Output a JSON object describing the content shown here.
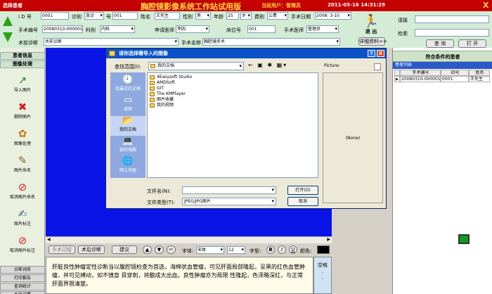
{
  "titlebar": {
    "app_name": "选择患者",
    "title": "胸腔镜影像系统工作站试用版",
    "user": "当前用户：管理员",
    "clock": "2011-05-16 14:31:29",
    "close": "X"
  },
  "form": {
    "row1": {
      "id_label": "I D 号",
      "id_value": "0001",
      "visit_label": "诊别",
      "visit_value": "急诊",
      "no_label": "号",
      "no_value": "001",
      "name_label": "姓名",
      "name_value": "王先生",
      "sex_label": "性别",
      "sex_value": "男",
      "age_label": "年龄",
      "age_value": "25",
      "age_unit_value": "岁",
      "fee_label": "费别",
      "fee_value": "公费",
      "date_label": "手术日期",
      "date_value": "2008- 3-10"
    },
    "row2": {
      "opno_label": "手术编号",
      "opno_value": "20080310-000001",
      "dept_label": "科别",
      "dept_value": "内科",
      "doctor_label": "申请医师",
      "doctor_value": "李四",
      "bed_label": "床位号",
      "bed_value": "001",
      "surgeon_label": "手术医师",
      "surgeon_value": "管理员"
    },
    "row3": {
      "preop_label": "术前诊断",
      "preop_value": "术前诊断",
      "opname_label": "手术名称",
      "opname_value": "胸腔镜手术"
    },
    "exit_label": "退 出",
    "detail_button": "详细资料>>",
    "side": {
      "report_label": "请报",
      "search_label": "检索",
      "query_button": "查 询",
      "open_button": "打 开"
    }
  },
  "left_panel": {
    "patient_info": "患者信息",
    "image_process": "图像处理",
    "tools": [
      {
        "icon": "↗",
        "label": "导入图片",
        "color": "#2a7a2a"
      },
      {
        "icon": "✖",
        "label": "删除图片",
        "color": "#d32020"
      },
      {
        "icon": "✿",
        "label": "图像处理",
        "color": "#c07a10"
      },
      {
        "icon": "✎",
        "label": "图片命名",
        "color": "#806020"
      },
      {
        "icon": "⊘",
        "label": "取消图片命名",
        "color": "#d32020"
      },
      {
        "icon": "✍",
        "label": "图片标注",
        "color": "#406080"
      },
      {
        "icon": "⊘",
        "label": "取消图片标注",
        "color": "#d32020"
      }
    ],
    "bottom_menu": [
      "诊断词库",
      "打印报告",
      "查询统计",
      "系统设置"
    ]
  },
  "editor_toolbar": {
    "buttons": [
      "手术过程",
      "术后诊断",
      "建议"
    ],
    "font_label": "字体:",
    "font_value": "宋体",
    "size_value": "12",
    "style_label": "字型:",
    "bold": "B",
    "italic": "I",
    "underline": "U",
    "color_label": "颜色:"
  },
  "editor_text": "肝脏良性肿瘤定性诊断当以腹腔镜检查为首选，海绵状血管瘤，可见肝面局部隆起，呈黑的红色血管肿瘤，并可见搏动，如不慎盲 目穿刺，将酿成大出血。良性肿瘤亦为局限 性隆起，色泽略深红，与正常肝面界限清楚。",
  "side_button": "空格\n.\n,",
  "right_panel": {
    "header": "符合条件的患者",
    "list_title": "患者列表",
    "columns": [
      "手术编号",
      "ID号",
      "姓名"
    ],
    "rows": [
      [
        "20080310-000001",
        "0001",
        "王先生"
      ]
    ]
  },
  "dialog": {
    "title": "请你选择需导入的图像",
    "help": "?",
    "close": "X",
    "lookin_label": "查找范围(I):",
    "lookin_value": "我的文档",
    "nav_icons": "← ▣ ✱ ▦▾",
    "places": [
      {
        "icon": "🕘",
        "label": "我最近的文档"
      },
      {
        "icon": "▭",
        "label": "桌面"
      },
      {
        "icon": "📂",
        "label": "我的文档"
      },
      {
        "icon": "💻",
        "label": "我的电脑"
      },
      {
        "icon": "🌐",
        "label": "网上邻居"
      }
    ],
    "files": [
      "4Easysoft Studio",
      "AMDSoft",
      "GIT",
      "The KMPlayer",
      "图片收藏",
      "我的视频"
    ],
    "picture_label": "Picture:",
    "picture_none": "(None)",
    "filename_label": "文件名(N):",
    "filename_value": "",
    "filetype_label": "文件类型(T):",
    "filetype_value": "JPEG/JPG图片",
    "open_button": "打开(O)",
    "cancel_button": "取消"
  }
}
